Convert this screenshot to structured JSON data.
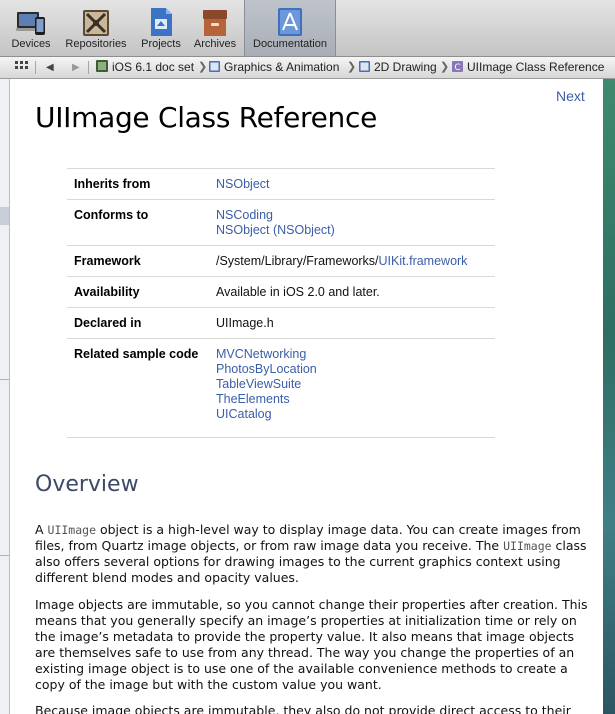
{
  "toolbar": {
    "buttons": [
      {
        "label": "Devices",
        "icon": "devices-icon"
      },
      {
        "label": "Repositories",
        "icon": "repositories-icon"
      },
      {
        "label": "Projects",
        "icon": "projects-icon"
      },
      {
        "label": "Archives",
        "icon": "archives-icon"
      },
      {
        "label": "Documentation",
        "icon": "documentation-icon",
        "active": true
      }
    ]
  },
  "jumpbar": {
    "crumbs": [
      "iOS 6.1 doc set",
      "Graphics & Animation",
      "2D Drawing",
      "UIImage Class Reference"
    ],
    "crumb_icon_color": "#4a6fb0"
  },
  "content": {
    "next_label": "Next",
    "title": "UIImage Class Reference",
    "spec": {
      "inherits_label": "Inherits from",
      "inherits_value": "NSObject",
      "conforms_label": "Conforms to",
      "conforms_values": [
        "NSCoding",
        "NSObject (NSObject)"
      ],
      "framework_label": "Framework",
      "framework_path": "/System/Library/Frameworks/",
      "framework_link": "UIKit.framework",
      "availability_label": "Availability",
      "availability_value": "Available in iOS 2.0 and later.",
      "declared_label": "Declared in",
      "declared_value": "UIImage.h",
      "samples_label": "Related sample code",
      "samples": [
        "MVCNetworking",
        "PhotosByLocation",
        "TableViewSuite",
        "TheElements",
        "UICatalog"
      ]
    },
    "overview_heading": "Overview",
    "p1": {
      "a": "A ",
      "code1": "UIImage",
      "b": " object is a high-level way to display image data. You can create images from files, from Quartz image objects, or from raw image data you receive. The ",
      "code2": "UIImage",
      "c": " class also offers several options for drawing images to the current graphics context using different blend modes and opacity values."
    },
    "p2": "Image objects are immutable, so you cannot change their properties after creation. This means that you generally specify an image’s properties at initialization time or rely on the image’s metadata to provide the property value. It also means that image objects are themselves safe to use from any thread. The way you change the properties of an existing image object is to use one of the available convenience methods to create a copy of the image but with the custom value you want.",
    "p3": "Because image objects are immutable, they also do not provide direct access to their"
  },
  "colors": {
    "link": "#3a5ea8",
    "heading": "#3b4a66"
  }
}
